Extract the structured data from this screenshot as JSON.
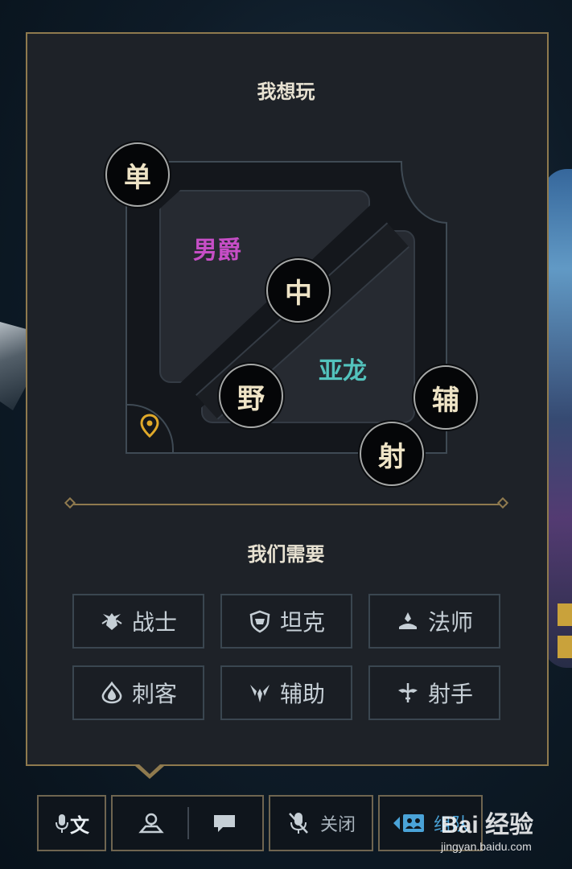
{
  "panel": {
    "title": "我想玩",
    "section_title": "我们需要"
  },
  "map": {
    "lanes": [
      {
        "id": "top",
        "label": "单"
      },
      {
        "id": "mid",
        "label": "中"
      },
      {
        "id": "jungle",
        "label": "野"
      },
      {
        "id": "support",
        "label": "辅"
      },
      {
        "id": "adc",
        "label": "射"
      }
    ],
    "objective_labels": [
      {
        "id": "baron",
        "text": "男爵",
        "color": "#c64ec6"
      },
      {
        "id": "dragon",
        "text": "亚龙",
        "color": "#53c3bd"
      }
    ],
    "location_icon": "location-pin-icon"
  },
  "roles": [
    {
      "icon": "fighter-icon",
      "label": "战士"
    },
    {
      "icon": "tank-icon",
      "label": "坦克"
    },
    {
      "icon": "mage-icon",
      "label": "法师"
    },
    {
      "icon": "assassin-icon",
      "label": "刺客"
    },
    {
      "icon": "support-icon",
      "label": "辅助"
    },
    {
      "icon": "marksman-icon",
      "label": "射手"
    }
  ],
  "bottom_bar": {
    "voice_text_icon": "voice-text-icon",
    "voice_text_label": "文",
    "position_icon": "person-pin-icon",
    "chat_icon": "chat-icon",
    "mic_icon": "mic-off-icon",
    "mic_label": "关闭",
    "party_icon": "party-icon",
    "party_label": "组队"
  },
  "watermark": {
    "main": "Bai 经验",
    "sub": "jingyan.baidu.com"
  },
  "colors": {
    "accent_gold": "#8f7a4e",
    "panel_bg": "#1e2228",
    "baron": "#c64ec6",
    "dragon": "#53c3bd",
    "pin": "#e0a92a"
  }
}
